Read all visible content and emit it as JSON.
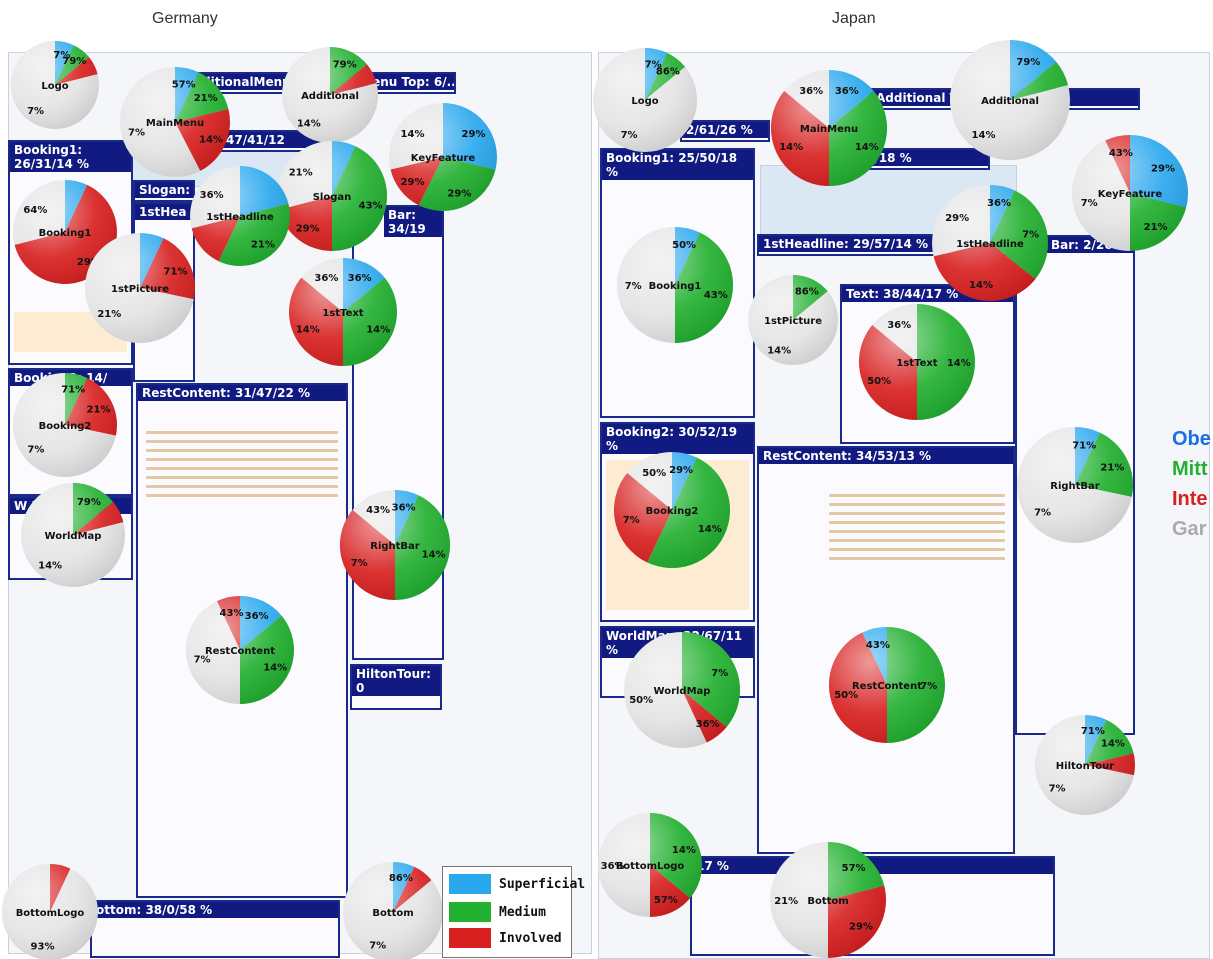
{
  "labels": {
    "germany": "Germany",
    "japan": "Japan"
  },
  "colors": {
    "superficial": "#2aa8ee",
    "medium": "#22b030",
    "involved": "#d82020",
    "unseen": "#e4e4e4"
  },
  "legend": [
    {
      "key": "superficial",
      "label": "Superficial"
    },
    {
      "key": "medium",
      "label": "Medium"
    },
    {
      "key": "involved",
      "label": "Involved"
    }
  ],
  "side_legend": [
    "Obe",
    "Mitt",
    "Inte",
    "Gar"
  ],
  "regions": {
    "germany": [
      {
        "id": "g-booking1",
        "label": "Booking1: 26/31/14 %"
      },
      {
        "id": "g-booking2",
        "label": "Booking2: 14/"
      },
      {
        "id": "g-worldmap",
        "label": "W E"
      },
      {
        "id": "g-slogan",
        "label": "Slogan:"
      },
      {
        "id": "g-1sthead",
        "label": "1stHea"
      },
      {
        "id": "g-mainmenu",
        "label": "47/41/12"
      },
      {
        "id": "g-additional",
        "label": "ditionalMenuAdditionalMenu Top: 6/..."
      },
      {
        "id": "g-restcontent",
        "label": "RestContent: 31/47/22 %"
      },
      {
        "id": "g-rightbar",
        "label": "Bar: 34/19"
      },
      {
        "id": "g-hiltontour",
        "label": "HiltonTour: 0"
      },
      {
        "id": "g-bottom",
        "label": "ottom: 38/0/58 %"
      }
    ],
    "japan": [
      {
        "id": "j-booking1",
        "label": "Booking1: 25/50/18 %"
      },
      {
        "id": "j-booking2",
        "label": "Booking2: 30/52/19 %"
      },
      {
        "id": "j-worldmap",
        "label": "WorldMap: 22/67/11 %"
      },
      {
        "id": "j-1sthead",
        "label": "1stHeadline: 29/57/14 %"
      },
      {
        "id": "j-1sttext",
        "label": "Text: 38/44/17 %"
      },
      {
        "id": "j-restcontent",
        "label": "RestContent: 34/53/13 %"
      },
      {
        "id": "j-mainmenu",
        "label": "2/61/26 %"
      },
      {
        "id": "j-kv",
        "label": "5/18 %"
      },
      {
        "id": "j-additional",
        "label": "Additional Top: 8 %"
      },
      {
        "id": "j-rightbar",
        "label": "Bar: 2/26 %"
      },
      {
        "id": "j-bottom",
        "label": "17 %"
      }
    ]
  },
  "chart_data": [
    {
      "type": "pie",
      "country": "Germany",
      "name": "Logo",
      "values": [
        [
          "superficial",
          7
        ],
        [
          "medium",
          7
        ],
        [
          "involved",
          7
        ],
        [
          "unseen",
          79
        ]
      ],
      "labels_shown": [
        "7%",
        "7%",
        "79%"
      ]
    },
    {
      "type": "pie",
      "country": "Germany",
      "name": "MainMenu",
      "values": [
        [
          "superficial",
          7
        ],
        [
          "medium",
          14
        ],
        [
          "involved",
          21
        ],
        [
          "unseen",
          57
        ]
      ],
      "labels_shown": [
        "7%",
        "14%",
        "21%",
        "57%"
      ]
    },
    {
      "type": "pie",
      "country": "Germany",
      "name": "Additional",
      "values": [
        [
          "medium",
          14
        ],
        [
          "involved",
          7
        ],
        [
          "unseen",
          79
        ]
      ],
      "labels_shown": [
        "14%",
        "79%"
      ]
    },
    {
      "type": "pie",
      "country": "Germany",
      "name": "KeyFeature",
      "values": [
        [
          "superficial",
          29
        ],
        [
          "medium",
          29
        ],
        [
          "involved",
          14
        ],
        [
          "unseen",
          29
        ]
      ],
      "labels_shown": [
        "29%",
        "29%",
        "14%",
        "29%"
      ]
    },
    {
      "type": "pie",
      "country": "Germany",
      "name": "Slogan",
      "values": [
        [
          "superficial",
          7
        ],
        [
          "medium",
          43
        ],
        [
          "involved",
          21
        ],
        [
          "unseen",
          29
        ]
      ],
      "labels_shown": [
        "43%",
        "21%",
        "29%"
      ]
    },
    {
      "type": "pie",
      "country": "Germany",
      "name": "Booking1",
      "values": [
        [
          "superficial",
          7
        ],
        [
          "involved",
          64
        ],
        [
          "unseen",
          29
        ]
      ],
      "labels_shown": [
        "29%",
        "64%"
      ]
    },
    {
      "type": "pie",
      "country": "Germany",
      "name": "1stHeadline",
      "values": [
        [
          "superficial",
          21
        ],
        [
          "medium",
          36
        ],
        [
          "involved",
          14
        ],
        [
          "unseen",
          29
        ]
      ],
      "labels_shown": [
        "21%",
        "36%"
      ]
    },
    {
      "type": "pie",
      "country": "Germany",
      "name": "1stPicture",
      "values": [
        [
          "superficial",
          7
        ],
        [
          "involved",
          21
        ],
        [
          "unseen",
          71
        ]
      ],
      "labels_shown": [
        "21%",
        "71%"
      ]
    },
    {
      "type": "pie",
      "country": "Germany",
      "name": "1stText",
      "values": [
        [
          "superficial",
          14
        ],
        [
          "medium",
          36
        ],
        [
          "involved",
          36
        ],
        [
          "unseen",
          14
        ]
      ],
      "labels_shown": [
        "14%",
        "14%",
        "36%",
        "36%"
      ]
    },
    {
      "type": "pie",
      "country": "Germany",
      "name": "Booking2",
      "values": [
        [
          "medium",
          7
        ],
        [
          "involved",
          21
        ],
        [
          "unseen",
          71
        ]
      ],
      "labels_shown": [
        "7%",
        "21%",
        "71%"
      ]
    },
    {
      "type": "pie",
      "country": "Germany",
      "name": "WorldMap",
      "values": [
        [
          "medium",
          14
        ],
        [
          "involved",
          7
        ],
        [
          "unseen",
          79
        ]
      ],
      "labels_shown": [
        "14%",
        "79%"
      ]
    },
    {
      "type": "pie",
      "country": "Germany",
      "name": "RightBar",
      "values": [
        [
          "superficial",
          7
        ],
        [
          "medium",
          43
        ],
        [
          "involved",
          36
        ],
        [
          "unseen",
          14
        ]
      ],
      "labels_shown": [
        "14%",
        "7%",
        "43%",
        "36%"
      ]
    },
    {
      "type": "pie",
      "country": "Germany",
      "name": "RestContent",
      "values": [
        [
          "superficial",
          14
        ],
        [
          "medium",
          36
        ],
        [
          "unseen",
          43
        ],
        [
          "involved",
          7
        ]
      ],
      "labels_shown": [
        "7%",
        "14%",
        "36%",
        "43%"
      ]
    },
    {
      "type": "pie",
      "country": "Germany",
      "name": "BottomLogo",
      "values": [
        [
          "involved",
          7
        ],
        [
          "unseen",
          93
        ]
      ],
      "labels_shown": [
        "93%"
      ]
    },
    {
      "type": "pie",
      "country": "Germany",
      "name": "Bottom",
      "values": [
        [
          "superficial",
          7
        ],
        [
          "involved",
          7
        ],
        [
          "unseen",
          86
        ]
      ],
      "labels_shown": [
        "7%",
        "86%"
      ]
    },
    {
      "type": "pie",
      "country": "Japan",
      "name": "Logo",
      "values": [
        [
          "superficial",
          7
        ],
        [
          "medium",
          7
        ],
        [
          "unseen",
          86
        ]
      ],
      "labels_shown": [
        "7%",
        "7%",
        "86%"
      ]
    },
    {
      "type": "pie",
      "country": "Japan",
      "name": "MainMenu",
      "values": [
        [
          "superficial",
          14
        ],
        [
          "medium",
          36
        ],
        [
          "involved",
          36
        ],
        [
          "unseen",
          14
        ]
      ],
      "labels_shown": [
        "14%",
        "14%",
        "36%",
        "36%"
      ]
    },
    {
      "type": "pie",
      "country": "Japan",
      "name": "Additional",
      "values": [
        [
          "superficial",
          14
        ],
        [
          "medium",
          7
        ],
        [
          "unseen",
          79
        ]
      ],
      "labels_shown": [
        "14%",
        "79%"
      ]
    },
    {
      "type": "pie",
      "country": "Japan",
      "name": "KeyFeature",
      "values": [
        [
          "superficial",
          29
        ],
        [
          "medium",
          21
        ],
        [
          "unseen",
          43
        ],
        [
          "involved",
          7
        ]
      ],
      "labels_shown": [
        "7%",
        "29%",
        "21%",
        "43%"
      ]
    },
    {
      "type": "pie",
      "country": "Japan",
      "name": "1stHeadline",
      "values": [
        [
          "superficial",
          7
        ],
        [
          "medium",
          29
        ],
        [
          "involved",
          36
        ],
        [
          "unseen",
          29
        ]
      ],
      "labels_shown": [
        "14%",
        "7%",
        "29%",
        "36%"
      ]
    },
    {
      "type": "pie",
      "country": "Japan",
      "name": "Booking1",
      "values": [
        [
          "superficial",
          7
        ],
        [
          "medium",
          43
        ],
        [
          "unseen",
          50
        ]
      ],
      "labels_shown": [
        "7%",
        "43%",
        "50%"
      ]
    },
    {
      "type": "pie",
      "country": "Japan",
      "name": "1stPicture",
      "values": [
        [
          "medium",
          14
        ],
        [
          "unseen",
          86
        ]
      ],
      "labels_shown": [
        "14%",
        "86%"
      ]
    },
    {
      "type": "pie",
      "country": "Japan",
      "name": "1stText",
      "values": [
        [
          "medium",
          50
        ],
        [
          "involved",
          36
        ],
        [
          "unseen",
          14
        ]
      ],
      "labels_shown": [
        "14%",
        "50%",
        "36%"
      ]
    },
    {
      "type": "pie",
      "country": "Japan",
      "name": "Booking2",
      "values": [
        [
          "superficial",
          7
        ],
        [
          "medium",
          50
        ],
        [
          "involved",
          29
        ],
        [
          "unseen",
          14
        ]
      ],
      "labels_shown": [
        "14%",
        "7%",
        "50%",
        "29%"
      ]
    },
    {
      "type": "pie",
      "country": "Japan",
      "name": "WorldMap",
      "values": [
        [
          "medium",
          36
        ],
        [
          "involved",
          7
        ],
        [
          "unseen",
          57
        ]
      ],
      "labels_shown": [
        "50%",
        "7%",
        "36%"
      ]
    },
    {
      "type": "pie",
      "country": "Japan",
      "name": "RestContent",
      "values": [
        [
          "medium",
          50
        ],
        [
          "involved",
          43
        ],
        [
          "superficial",
          7
        ]
      ],
      "labels_shown": [
        "7%",
        "50%",
        "43%"
      ]
    },
    {
      "type": "pie",
      "country": "Japan",
      "name": "RightBar",
      "values": [
        [
          "superficial",
          7
        ],
        [
          "medium",
          21
        ],
        [
          "unseen",
          71
        ]
      ],
      "labels_shown": [
        "7%",
        "21%",
        "71%"
      ]
    },
    {
      "type": "pie",
      "country": "Japan",
      "name": "HiltonTour",
      "values": [
        [
          "superficial",
          7
        ],
        [
          "medium",
          14
        ],
        [
          "involved",
          7
        ],
        [
          "unseen",
          71
        ]
      ],
      "labels_shown": [
        "7%",
        "14%",
        "71%"
      ]
    },
    {
      "type": "pie",
      "country": "Japan",
      "name": "BottomLogo",
      "values": [
        [
          "medium",
          36
        ],
        [
          "involved",
          14
        ],
        [
          "unseen",
          50
        ]
      ],
      "labels_shown": [
        "36%",
        "14%",
        "57%"
      ]
    },
    {
      "type": "pie",
      "country": "Japan",
      "name": "Bottom",
      "values": [
        [
          "medium",
          21
        ],
        [
          "involved",
          29
        ],
        [
          "unseen",
          50
        ]
      ],
      "labels_shown": [
        "21%",
        "29%",
        "57%"
      ]
    }
  ]
}
